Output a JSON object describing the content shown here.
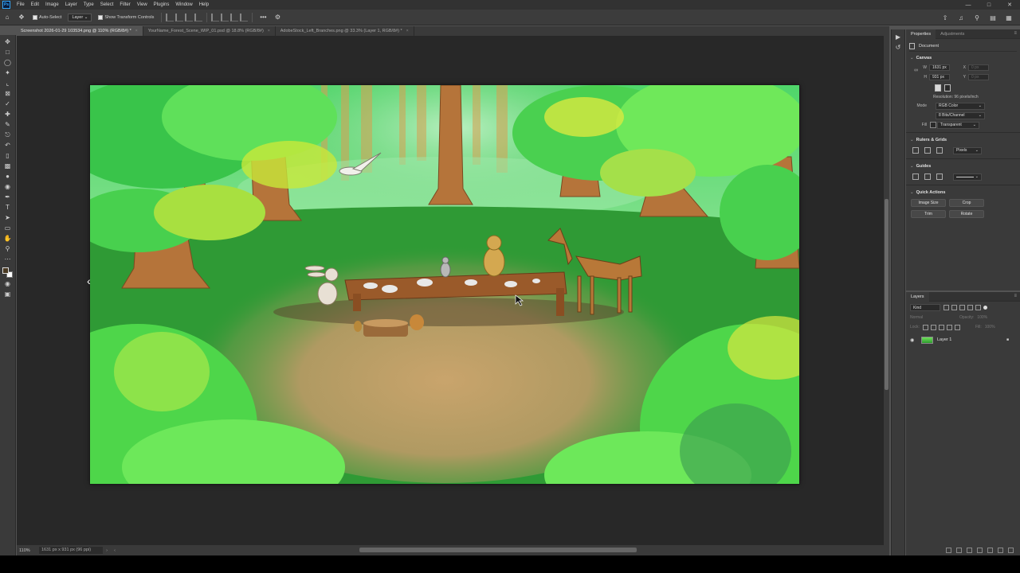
{
  "menu": {
    "logo": "Ps",
    "items": [
      "File",
      "Edit",
      "Image",
      "Layer",
      "Type",
      "Select",
      "Filter",
      "View",
      "Plugins",
      "Window",
      "Help"
    ]
  },
  "options": {
    "auto_select_label": "Auto-Select",
    "auto_select_target": "Layer",
    "show_transform_label": "Show Transform Controls",
    "more_label": "•••"
  },
  "tabs": [
    {
      "label": "Screenshot 2026-01-29 103534.png @ 110% (RGB/8#) *",
      "close": "×"
    },
    {
      "label": "YourName_Forest_Scene_WIP_01.psd @ 18.8% (RGB/8#)",
      "close": "×"
    },
    {
      "label": "AdobeStock_Left_Branches.png @ 33.3% (Layer 1, RGB/8#) *",
      "close": "×"
    }
  ],
  "status": {
    "zoom": "110%",
    "doc_size": "1631 px x 931 px (96 ppi)",
    "arrow": "›",
    "arrow_left": "‹"
  },
  "properties": {
    "tabs": [
      "Properties",
      "Adjustments"
    ],
    "document_label": "Document",
    "canvas_label": "Canvas",
    "width_label": "W",
    "width_value": "1631 px",
    "height_label": "H",
    "height_value": "931 px",
    "x_label": "X",
    "x_value": "0 px",
    "y_label": "Y",
    "y_value": "0 px",
    "resolution": "Resolution: 96 pixels/inch",
    "mode_label": "Mode",
    "mode_value": "RGB Color",
    "bits_value": "8 Bits/Channel",
    "fill_label": "Fill",
    "fill_value": "Transparent",
    "rulers_label": "Rulers & Grids",
    "units_value": "Pixels",
    "guides_label": "Guides",
    "quick_actions_label": "Quick Actions",
    "qa_buttons": [
      "Image Size",
      "Crop",
      "Trim",
      "Rotate"
    ]
  },
  "layers": {
    "tab": "Layers",
    "kind": "Kind",
    "blend": "Normal",
    "opacity_label": "Opacity:",
    "opacity_value": "100%",
    "lock_label": "Lock:",
    "fill_label": "Fill:",
    "fill_value": "100%",
    "items": [
      {
        "name": "Layer 1",
        "visible": true,
        "locked": true
      }
    ]
  },
  "colors": {
    "accent": "#31a8ff",
    "foreground": "#4a3a22",
    "background": "#ffffff"
  }
}
